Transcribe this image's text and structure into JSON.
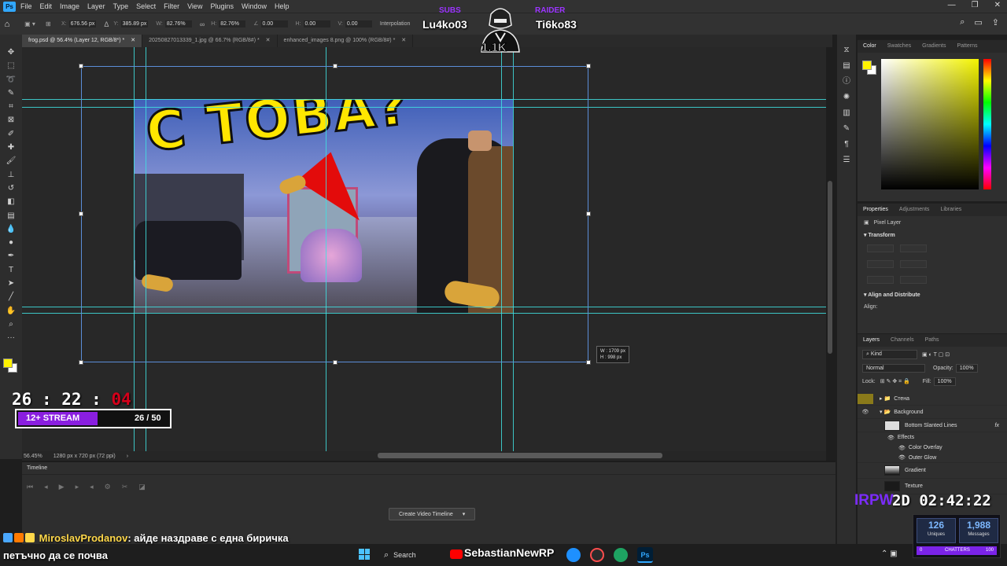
{
  "menubar": {
    "app_badge": "Ps",
    "items": [
      "File",
      "Edit",
      "Image",
      "Layer",
      "Type",
      "Select",
      "Filter",
      "View",
      "Plugins",
      "Window",
      "Help"
    ]
  },
  "options_bar": {
    "fields": [
      {
        "label": "X:",
        "value": "676.56 px"
      },
      {
        "label": "Y:",
        "value": "385.89 px"
      },
      {
        "label": "W:",
        "value": "82.76%"
      },
      {
        "label": "H:",
        "value": "82.76%"
      },
      {
        "label": "∠",
        "value": "0.00"
      },
      {
        "label": "H:",
        "value": "0.00"
      },
      {
        "label": "V:",
        "value": "0.00"
      }
    ],
    "interpolation_label": "Interpolation"
  },
  "tabs": [
    {
      "label": "frog.psd @ 56.4% (Layer 12, RGB/8*) *",
      "active": true
    },
    {
      "label": "20250827013339_1.jpg @ 66.7% (RGB/8#) *",
      "active": false
    },
    {
      "label": "enhanced_images 8.png @ 100% (RGB/8#) *",
      "active": false
    }
  ],
  "canvas": {
    "headline": "С ТОВА?",
    "transform_readout": {
      "w": "W :  1709 px",
      "h": "H :    998 px"
    }
  },
  "status_bar": {
    "zoom": "56.45%",
    "doc_info": "1280 px x 720 px (72 ppi)"
  },
  "timeline": {
    "title": "Timeline",
    "create_button": "Create Video Timeline"
  },
  "color_panel": {
    "tabs": [
      "Color",
      "Swatches",
      "Gradients",
      "Patterns"
    ],
    "fg_color": "#fff200"
  },
  "properties_panel": {
    "tabs": [
      "Properties",
      "Adjustments",
      "Libraries"
    ],
    "kind": "Pixel Layer",
    "transform_section": "Transform",
    "align_section": "Align and Distribute",
    "align_label": "Align:"
  },
  "layers_panel": {
    "tabs": [
      "Layers",
      "Channels",
      "Paths"
    ],
    "filter_label": "Kind",
    "blend_mode": "Normal",
    "opacity_label": "Opacity:",
    "opacity": "100%",
    "lock_label": "Lock:",
    "fill_label": "Fill:",
    "fill": "100%",
    "rows": [
      {
        "name": "Стена",
        "type": "group",
        "indent": 0
      },
      {
        "name": "Background",
        "type": "group",
        "indent": 0
      },
      {
        "name": "Bottom Slanted Lines",
        "type": "layer",
        "indent": 1,
        "fx": "fx"
      },
      {
        "name": "Effects",
        "type": "effect",
        "indent": 2
      },
      {
        "name": "Color Overlay",
        "type": "effect",
        "indent": 3
      },
      {
        "name": "Outer Glow",
        "type": "effect",
        "indent": 3
      },
      {
        "name": "Gradient",
        "type": "layer",
        "indent": 1
      },
      {
        "name": "Texture",
        "type": "layer",
        "indent": 1
      }
    ]
  },
  "overlay": {
    "top_left_label": "SUBS",
    "top_left_name": "Lu4ko03",
    "top_right_label": "RAIDER",
    "top_right_name": "Ti6ko83",
    "mascot_count": "1.1K",
    "timer": {
      "h": "26",
      "m": "22",
      "s": "04"
    },
    "goal": {
      "label": "12+ STREAM",
      "count": "26 / 50",
      "progress": 0.52
    },
    "clock_prefix": "IRPW",
    "clock": "2D 02:42:22",
    "stats": {
      "uniques": "126",
      "uniques_label": "Uniques",
      "messages": "1,988",
      "messages_label": "Messages",
      "chatters_left": "0",
      "chatters_label": "CHATTERS",
      "chatters_right": "100"
    },
    "chat": [
      {
        "user": "MiroslavProdanov",
        "message": ": айде наздраве с една биричка"
      },
      {
        "user": "",
        "message": "петъчно да се почва"
      }
    ]
  },
  "taskbar": {
    "search": "Search",
    "streamer": "SebastianNewRP",
    "ps_badge": "Ps"
  }
}
